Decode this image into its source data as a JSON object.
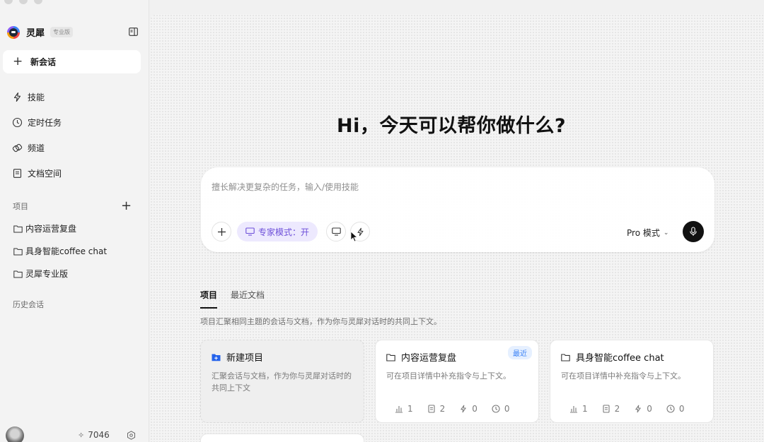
{
  "app": {
    "name": "灵犀",
    "badge": "专业版"
  },
  "sidebar": {
    "new_chat": "新会话",
    "nav": [
      {
        "label": "技能",
        "icon": "lightning-icon"
      },
      {
        "label": "定时任务",
        "icon": "clock-icon"
      },
      {
        "label": "频道",
        "icon": "channel-icon"
      },
      {
        "label": "文档空间",
        "icon": "document-icon"
      }
    ],
    "projects_label": "项目",
    "projects": [
      "内容运营复盘",
      "具身智能coffee chat",
      "灵犀专业版"
    ],
    "history_label": "历史会话",
    "credits": "7046"
  },
  "main": {
    "greeting": "Hi，今天可以帮你做什么?",
    "composer": {
      "placeholder": "擅长解决更复杂的任务，输入/使用技能",
      "expert_mode": "专家模式：开",
      "mode": "Pro 模式"
    },
    "tabs": [
      "项目",
      "最近文档"
    ],
    "tab_description": "项目汇聚相同主题的会话与文档，作为你与灵犀对话时的共同上下文。",
    "new_project": {
      "title": "新建项目",
      "desc": "汇聚会话与文档，作为你与灵犀对话时的共同上下文"
    },
    "projects": [
      {
        "title": "内容运营复盘",
        "tag": "最近",
        "desc": "可在项目详情中补充指令与上下文。",
        "stats": {
          "chats": "1",
          "docs": "2",
          "skills": "0",
          "tasks": "0"
        }
      },
      {
        "title": "具身智能coffee chat",
        "tag": "",
        "desc": "可在项目详情中补充指令与上下文。",
        "stats": {
          "chats": "1",
          "docs": "2",
          "skills": "0",
          "tasks": "0"
        }
      }
    ]
  },
  "colors": {
    "accent_purple": "#6d4fd9",
    "tag_blue": "#3b82f6",
    "background": "#f4f4f4"
  }
}
